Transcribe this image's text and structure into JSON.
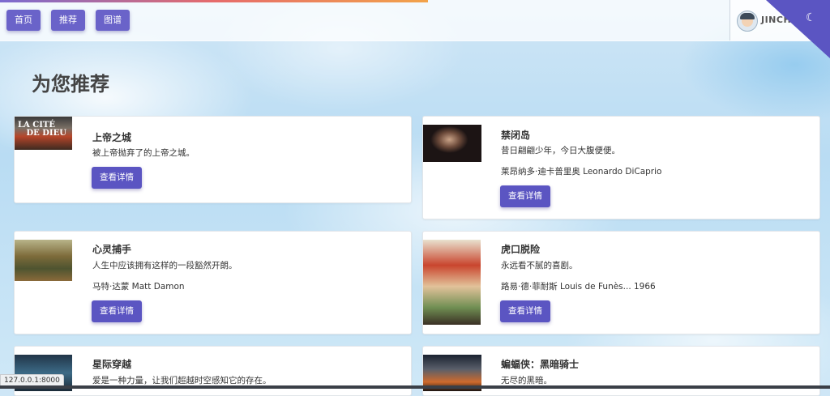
{
  "nav": {
    "home": "首页",
    "recommend": "推荐",
    "graph": "图谱",
    "username": "JINCHE"
  },
  "page": {
    "title": "为您推荐"
  },
  "poster_text": "LA CITÉ DE DIEU",
  "movies": [
    {
      "title": "上帝之城",
      "desc": "被上帝抛弃了的上帝之城。",
      "actor": "",
      "button": "查看详情"
    },
    {
      "title": "禁闭岛",
      "desc": "昔日翩翩少年，今日大腹便便。",
      "actor": "莱昂纳多·迪卡普里奥 Leonardo DiCaprio",
      "button": "查看详情"
    },
    {
      "title": "心灵捕手",
      "desc": "人生中应该拥有这样的一段豁然开朗。",
      "actor": "马特·达蒙 Matt Damon",
      "button": "查看详情"
    },
    {
      "title": "虎口脱险",
      "desc": "永远看不腻的喜剧。",
      "actor": "路易·德·菲耐斯 Louis de Funès... 1966",
      "button": "查看详情"
    },
    {
      "title": "星际穿越",
      "desc": "爱是一种力量，让我们超越时空感知它的存在。",
      "actor": "",
      "button": ""
    },
    {
      "title": "蝙蝠侠：黑暗骑士",
      "desc": "无尽的黑暗。",
      "actor": "",
      "button": ""
    }
  ],
  "status_url": "127.0.0.1:8000",
  "icons": {
    "theme_toggle": "moon-icon",
    "avatar": "avatar-icon"
  },
  "colors": {
    "accent": "#5b55c2",
    "nav_button": "#6a63c9"
  }
}
